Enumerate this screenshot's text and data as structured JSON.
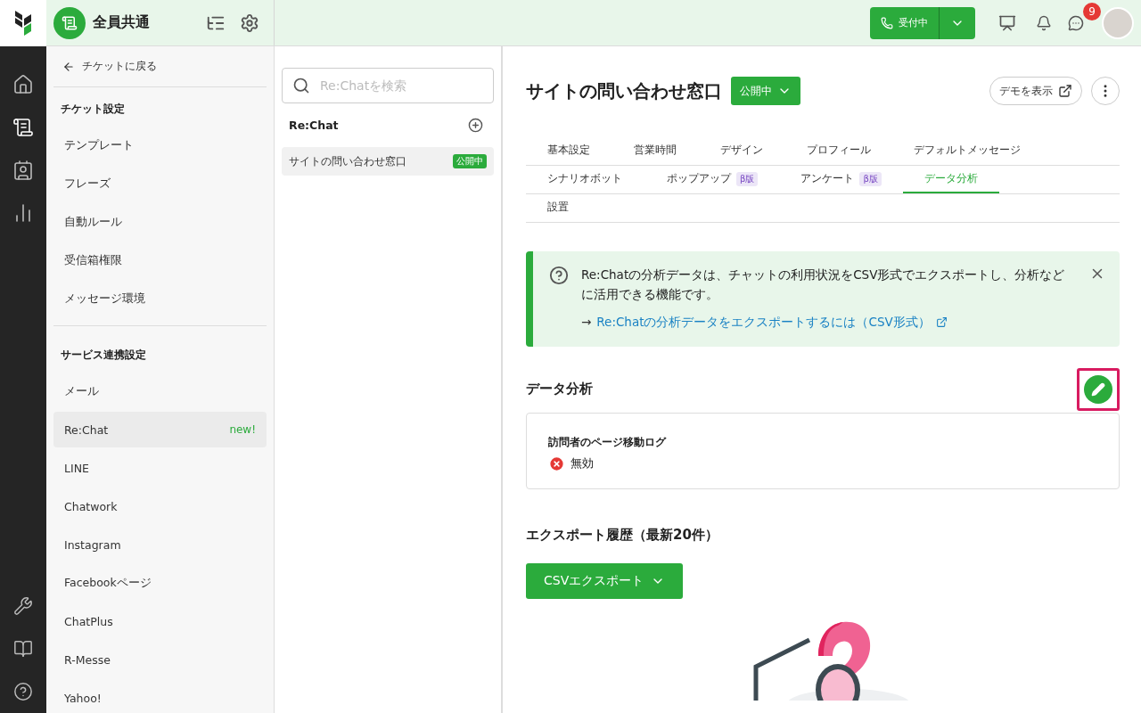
{
  "rail": {
    "top_items": [
      {
        "kind": "home",
        "selected": false
      },
      {
        "kind": "ticket",
        "selected": true
      },
      {
        "kind": "contacts",
        "selected": false
      },
      {
        "kind": "analytics",
        "selected": false
      }
    ],
    "bottom_items": [
      {
        "kind": "tools",
        "selected": false
      },
      {
        "kind": "book",
        "selected": false
      },
      {
        "kind": "help",
        "selected": false
      }
    ]
  },
  "header": {
    "workspace": "全員共通",
    "status_button": "受付中",
    "notification_count": "9"
  },
  "settings_nav": {
    "back": "チケットに戻る",
    "sections": [
      {
        "title": "チケット設定",
        "items": [
          {
            "label": "テンプレート",
            "selected": false
          },
          {
            "label": "フレーズ",
            "selected": false
          },
          {
            "label": "自動ルール",
            "selected": false
          },
          {
            "label": "受信箱権限",
            "selected": false
          },
          {
            "label": "メッセージ環境",
            "selected": false
          }
        ]
      },
      {
        "title": "サービス連携設定",
        "items": [
          {
            "label": "メール",
            "selected": false
          },
          {
            "label": "Re:Chat",
            "selected": true,
            "badge": "new!"
          },
          {
            "label": "LINE",
            "selected": false
          },
          {
            "label": "Chatwork",
            "selected": false
          },
          {
            "label": "Instagram",
            "selected": false
          },
          {
            "label": "Facebookページ",
            "selected": false
          },
          {
            "label": "ChatPlus",
            "selected": false
          },
          {
            "label": "R-Messe",
            "selected": false
          },
          {
            "label": "Yahoo!",
            "selected": false
          }
        ]
      }
    ]
  },
  "list": {
    "search_placeholder": "Re:Chatを検索",
    "heading": "Re:Chat",
    "items": [
      {
        "label": "サイトの問い合わせ窓口",
        "status": "公開中",
        "selected": true
      }
    ]
  },
  "main": {
    "title": "サイトの問い合わせ窓口",
    "status": "公開中",
    "demo_button": "デモを表示",
    "tab_rows": [
      [
        {
          "label": "基本設定",
          "selected": false
        },
        {
          "label": "営業時間",
          "selected": false
        },
        {
          "label": "デザイン",
          "selected": false
        },
        {
          "label": "プロフィール",
          "selected": false
        },
        {
          "label": "デフォルトメッセージ",
          "selected": false
        }
      ],
      [
        {
          "label": "シナリオボット",
          "selected": false
        },
        {
          "label": "ポップアップ",
          "selected": false,
          "badge": "β版"
        },
        {
          "label": "アンケート",
          "selected": false,
          "badge": "β版"
        },
        {
          "label": "データ分析",
          "selected": true
        }
      ],
      [
        {
          "label": "設置",
          "selected": false
        }
      ]
    ],
    "notice": {
      "arrow": "→",
      "text": "Re:Chatの分析データは、チャットの利用状況をCSV形式でエクスポートし、分析などに活用できる機能です。",
      "link": "Re:Chatの分析データをエクスポートするには（CSV形式）"
    },
    "analysis": {
      "title": "データ分析",
      "edit_highlighted": true,
      "setting": {
        "label": "訪問者のページ移動ログ",
        "value": "無効",
        "enabled": false
      }
    },
    "export": {
      "title": "エクスポート履歴（最新20件）",
      "button": "CSVエクスポート"
    }
  }
}
